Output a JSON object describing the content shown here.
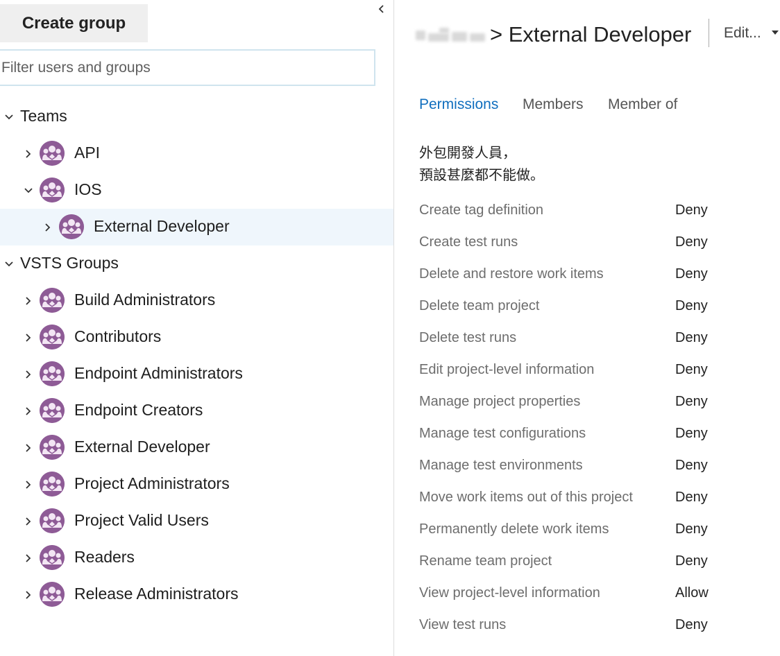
{
  "left": {
    "create_group_label": "Create group",
    "filter_placeholder": "Filter users and groups",
    "collapse_icon": "chevron-left-icon",
    "teams_label": "Teams",
    "teams": [
      {
        "label": "API",
        "expanded": false
      },
      {
        "label": "IOS",
        "expanded": true,
        "children": [
          {
            "label": "External Developer",
            "selected": true
          }
        ]
      }
    ],
    "vsts_label": "VSTS Groups",
    "vsts_groups": [
      "Build Administrators",
      "Contributors",
      "Endpoint Administrators",
      "Endpoint Creators",
      "External Developer",
      "Project Administrators",
      "Project Valid Users",
      "Readers",
      "Release Administrators"
    ]
  },
  "header": {
    "crumb_separator": ">",
    "title": "External Developer",
    "edit_label": "Edit...",
    "edit_caret_icon": "caret-down-icon"
  },
  "tabs": [
    "Permissions",
    "Members",
    "Member of"
  ],
  "active_tab": "Permissions",
  "description": [
    "外包開發人員，",
    "預設甚麼都不能做。"
  ],
  "permissions": [
    {
      "name": "Create tag definition",
      "value": "Deny"
    },
    {
      "name": "Create test runs",
      "value": "Deny"
    },
    {
      "name": "Delete and restore work items",
      "value": "Deny"
    },
    {
      "name": "Delete team project",
      "value": "Deny"
    },
    {
      "name": "Delete test runs",
      "value": "Deny"
    },
    {
      "name": "Edit project-level information",
      "value": "Deny"
    },
    {
      "name": "Manage project properties",
      "value": "Deny"
    },
    {
      "name": "Manage test configurations",
      "value": "Deny"
    },
    {
      "name": "Manage test environments",
      "value": "Deny"
    },
    {
      "name": "Move work items out of this project",
      "value": "Deny"
    },
    {
      "name": "Permanently delete work items",
      "value": "Deny"
    },
    {
      "name": "Rename team project",
      "value": "Deny"
    },
    {
      "name": "View project-level information",
      "value": "Allow"
    },
    {
      "name": "View test runs",
      "value": "Deny"
    }
  ],
  "colors": {
    "accent": "#106ebe",
    "avatar": "#8e5b96",
    "selected_row": "#eff6fc"
  }
}
